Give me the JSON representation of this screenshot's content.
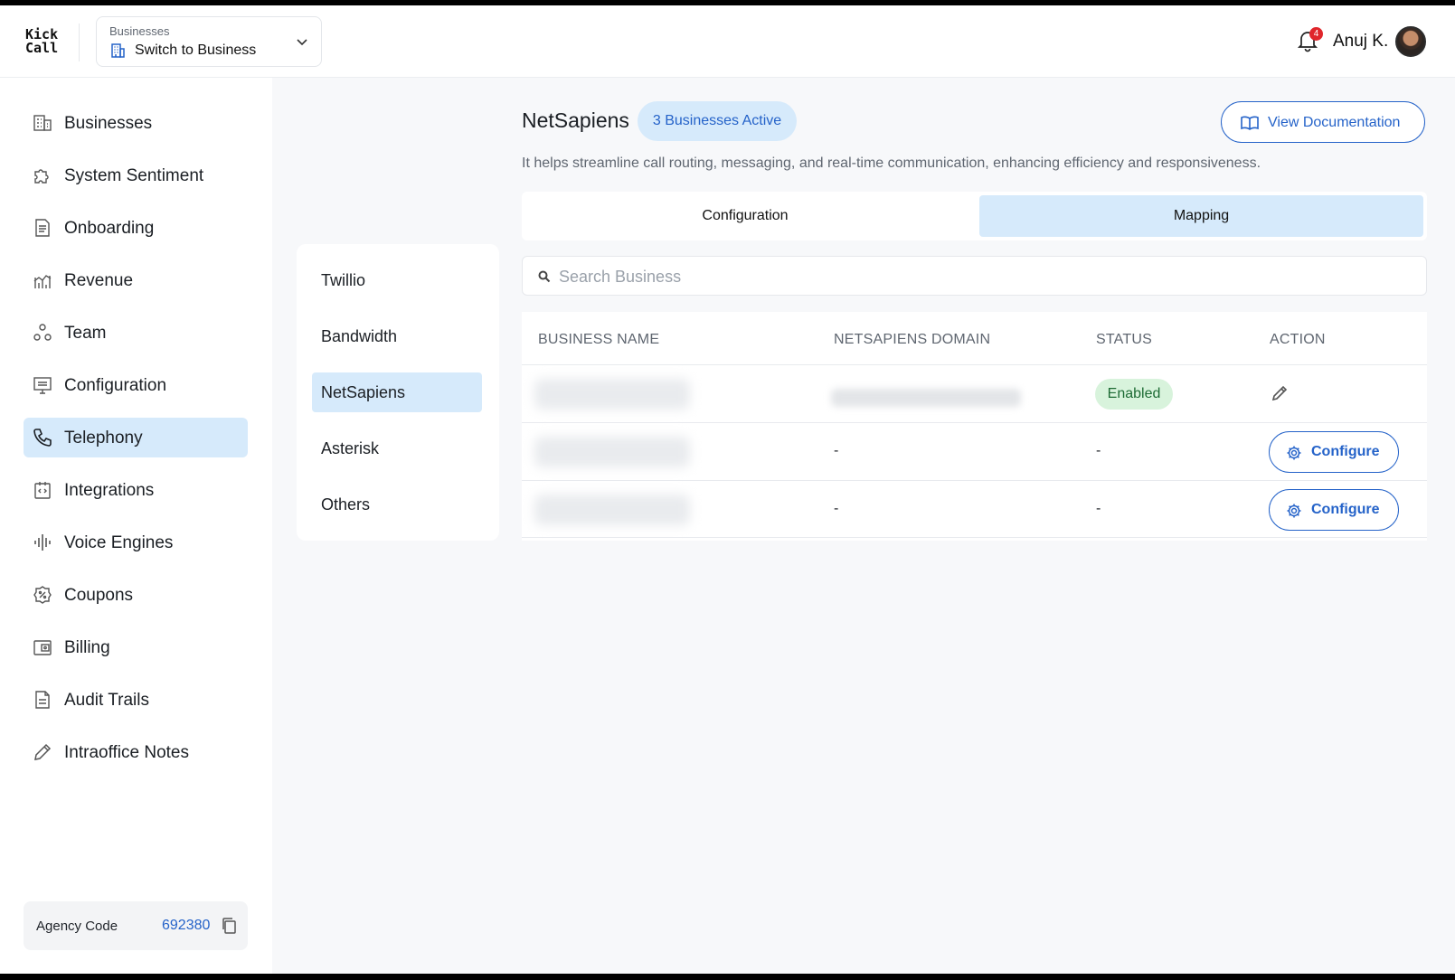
{
  "header": {
    "logo_line1": "Kick",
    "logo_line2": "Call",
    "business_switcher": {
      "caption": "Businesses",
      "value": "Switch to Business"
    },
    "notifications_count": "4",
    "user_name": "Anuj K."
  },
  "sidebar": {
    "items": [
      {
        "label": "Businesses",
        "icon": "building-icon"
      },
      {
        "label": "System Sentiment",
        "icon": "puzzle-icon"
      },
      {
        "label": "Onboarding",
        "icon": "document-icon"
      },
      {
        "label": "Revenue",
        "icon": "chart-icon"
      },
      {
        "label": "Team",
        "icon": "team-icon"
      },
      {
        "label": "Configuration",
        "icon": "config-icon"
      },
      {
        "label": "Telephony",
        "icon": "phone-icon",
        "active": true
      },
      {
        "label": "Integrations",
        "icon": "integrations-icon"
      },
      {
        "label": "Voice Engines",
        "icon": "waveform-icon"
      },
      {
        "label": "Coupons",
        "icon": "coupon-icon"
      },
      {
        "label": "Billing",
        "icon": "wallet-icon"
      },
      {
        "label": "Audit Trails",
        "icon": "audit-icon"
      },
      {
        "label": "Intraoffice Notes",
        "icon": "pencil-icon"
      }
    ],
    "agency": {
      "label": "Agency Code",
      "value": "692380"
    }
  },
  "providers": {
    "items": [
      "Twillio",
      "Bandwidth",
      "NetSapiens",
      "Asterisk",
      "Others"
    ],
    "active": "NetSapiens"
  },
  "main": {
    "title": "NetSapiens",
    "active_badge": "3 Businesses Active",
    "docs_button": "View Documentation",
    "description": "It helps streamline call routing, messaging, and real-time communication, enhancing efficiency and responsiveness.",
    "tabs": [
      {
        "label": "Configuration",
        "active": false
      },
      {
        "label": "Mapping",
        "active": true
      }
    ],
    "search_placeholder": "Search Business",
    "table": {
      "headers": [
        "BUSINESS NAME",
        "NETSAPIENS DOMAIN",
        "STATUS",
        "ACTION"
      ],
      "rows": [
        {
          "domain": "",
          "status": "Enabled",
          "action": "edit"
        },
        {
          "domain": "-",
          "status": "-",
          "action": "Configure"
        },
        {
          "domain": "-",
          "status": "-",
          "action": "Configure"
        }
      ]
    }
  },
  "colors": {
    "accent": "#2563c9",
    "active_bg": "#d6eafb",
    "enabled_bg": "#d8f3dc",
    "badge_red": "#e0262b"
  }
}
